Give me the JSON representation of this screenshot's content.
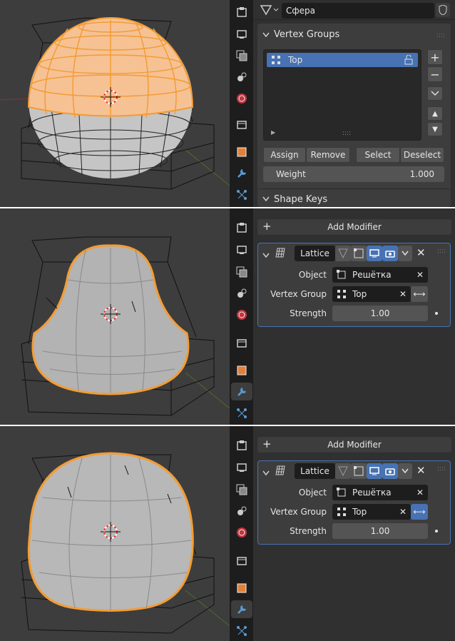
{
  "panel1": {
    "object_name": "Сфера",
    "vertex_groups": {
      "title": "Vertex Groups",
      "items": [
        "Top"
      ],
      "assign": "Assign",
      "remove": "Remove",
      "select": "Select",
      "deselect": "Deselect",
      "weight_label": "Weight",
      "weight_value": "1.000"
    },
    "shape_keys_title": "Shape Keys"
  },
  "panel2": {
    "add_modifier": "Add Modifier",
    "modifier_name": "Lattice",
    "object_label": "Object",
    "object_value": "Решётка",
    "vertex_group_label": "Vertex Group",
    "vertex_group_value": "Top",
    "strength_label": "Strength",
    "strength_value": "1.00",
    "invert_active": false
  },
  "panel3": {
    "add_modifier": "Add Modifier",
    "modifier_name": "Lattice",
    "object_label": "Object",
    "object_value": "Решётка",
    "vertex_group_label": "Vertex Group",
    "vertex_group_value": "Top",
    "strength_label": "Strength",
    "strength_value": "1.00",
    "invert_active": true
  },
  "colors": {
    "accent": "#4772b3",
    "selection": "#f39c35",
    "viewport": "#3d3d3d"
  }
}
